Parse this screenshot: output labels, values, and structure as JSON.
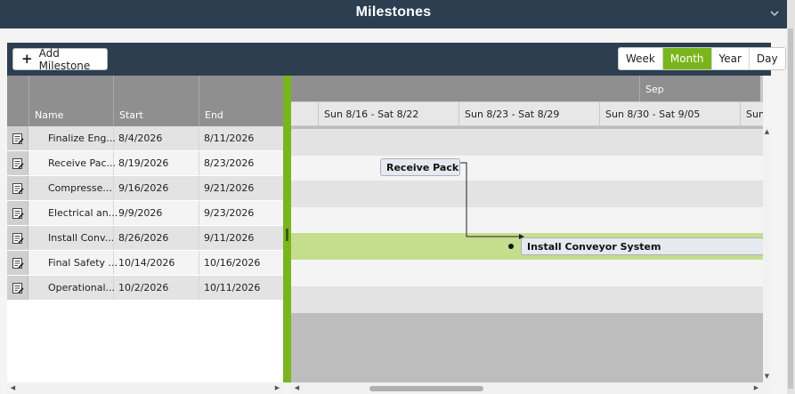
{
  "header": {
    "title": "Milestones"
  },
  "toolbar": {
    "add_label": "Add Milestone",
    "views": [
      {
        "label": "Week",
        "active": false
      },
      {
        "label": "Month",
        "active": true
      },
      {
        "label": "Year",
        "active": false
      },
      {
        "label": "Day",
        "active": false
      }
    ]
  },
  "grid": {
    "columns": [
      "Name",
      "Start",
      "End"
    ],
    "rows": [
      {
        "name": "Finalize Eng...",
        "start": "8/4/2026",
        "end": "8/11/2026"
      },
      {
        "name": "Receive Pac...",
        "start": "8/19/2026",
        "end": "8/23/2026"
      },
      {
        "name": "Compresse...",
        "start": "9/16/2026",
        "end": "9/21/2026"
      },
      {
        "name": "Electrical an...",
        "start": "9/9/2026",
        "end": "9/23/2026"
      },
      {
        "name": "Install Conv...",
        "start": "8/26/2026",
        "end": "9/11/2026"
      },
      {
        "name": "Final Safety ...",
        "start": "10/14/2026",
        "end": "10/16/2026"
      },
      {
        "name": "Operational...",
        "start": "10/2/2026",
        "end": "10/11/2026"
      }
    ]
  },
  "gantt": {
    "month_label": "Sep",
    "weeks": [
      "Sun 8/16 - Sat 8/22",
      "Sun 8/23 - Sat 8/29",
      "Sun 8/30 - Sat 9/05",
      "Sun"
    ],
    "bars": {
      "receive": "Receive Pack",
      "install": "Install Conveyor System"
    }
  },
  "colors": {
    "header_bg": "#2c3e50",
    "accent": "#7ab51d",
    "selected_row": "#c5de8e"
  }
}
